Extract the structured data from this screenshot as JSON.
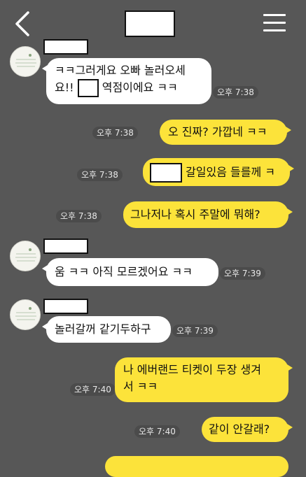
{
  "header": {
    "back_icon": "chevron-left-icon",
    "title": "",
    "menu_icon": "hamburger-menu-icon"
  },
  "messages": [
    {
      "dir": "in",
      "lines_before": "ㅋㅋ그러게요 오빠 놀러오세",
      "line2_pre": "요!! ",
      "line2_post": " 역점이에요 ㅋㅋ",
      "time": "오후 7:38"
    },
    {
      "dir": "out",
      "text": "오 진짜? 가깝네 ㅋㅋ",
      "time": "오후 7:38"
    },
    {
      "dir": "out",
      "text_post": " 갈일있음 들를께 ㅋ",
      "time": "오후 7:38"
    },
    {
      "dir": "out",
      "text": "그나저나 혹시 주말에 뭐해?",
      "time": "오후 7:38"
    },
    {
      "dir": "in",
      "text": "움 ㅋㅋ 아직 모르겠어요 ㅋㅋ",
      "time": "오후 7:39"
    },
    {
      "dir": "in",
      "text": "놀러갈꺼 같기두하구",
      "time": "오후 7:39"
    },
    {
      "dir": "out",
      "line1": "나 에버랜드 티켓이 두장 생겨",
      "line2": "서 ㅋㅋ",
      "time": "오후 7:40"
    },
    {
      "dir": "out",
      "text": "같이 안갈래?",
      "time": "오후 7:40"
    }
  ],
  "colors": {
    "background": "#575757",
    "outgoing": "#fce33a",
    "incoming": "#ffffff"
  }
}
